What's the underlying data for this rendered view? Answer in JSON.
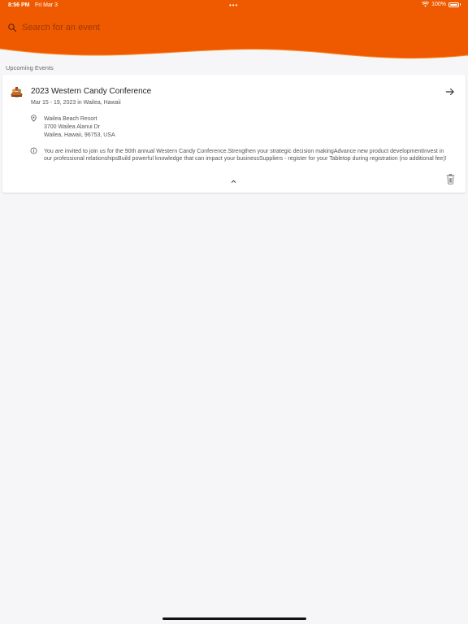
{
  "status_bar": {
    "time": "8:56 PM",
    "date": "Fri Mar 3",
    "battery": "100%",
    "battery_level": 1.0,
    "icons": [
      "wifi-icon",
      "battery-icon"
    ]
  },
  "colors": {
    "header": "#ef5a00",
    "background": "#f6f6f8",
    "card": "#ffffff"
  },
  "search": {
    "placeholder": "Search for an event",
    "icon": "search-icon"
  },
  "section": {
    "label": "Upcoming Events"
  },
  "event": {
    "title": "2023 Western Candy Conference",
    "subtitle": "Mar 15 - 19, 2023 in Wailea, Hawaii",
    "location": {
      "name": "Wailea Beach Resort",
      "street": "3700 Wailea Alanui Dr",
      "city": "Wailea, Hawaii, 96753, USA"
    },
    "description": "You are invited to join us for the 90th annual Western Candy Conference.Strengthen your strategic decision makingAdvance new product developmentInvest in our professional relationshipsBuild powerful knowledge that can impact your businessSuppliers - register for your Tabletop during registration (no additional fee)!",
    "icons": [
      "event-logo",
      "arrow-right-icon",
      "location-pin-icon",
      "info-icon",
      "chevron-up-icon",
      "trash-icon"
    ]
  }
}
